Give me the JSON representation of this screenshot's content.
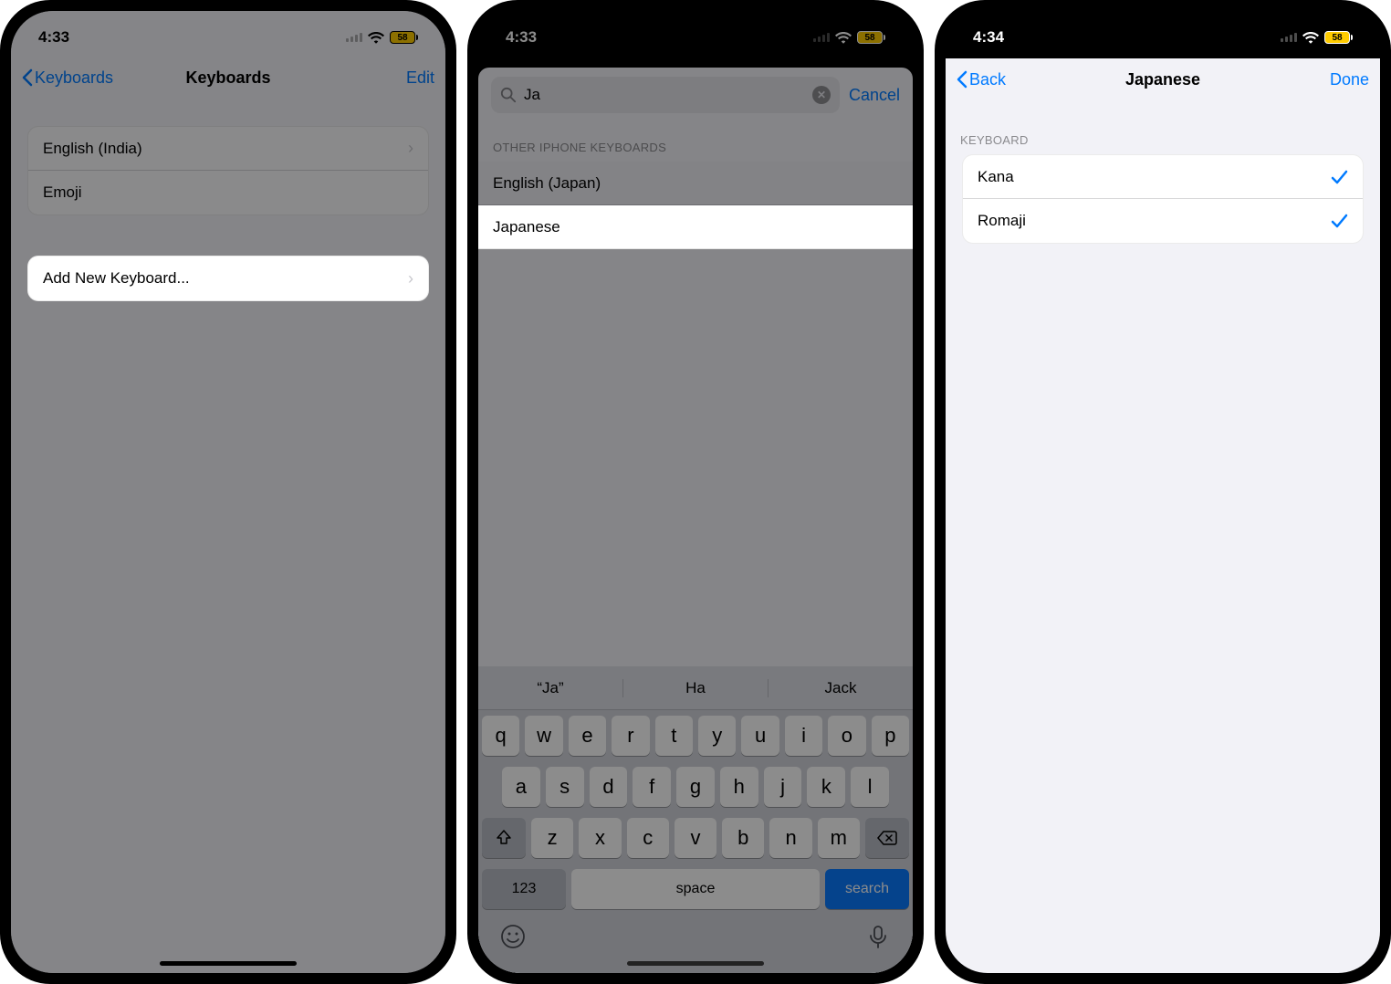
{
  "screen1": {
    "status": {
      "time": "4:33",
      "battery": "58"
    },
    "nav": {
      "back": "Keyboards",
      "title": "Keyboards",
      "edit": "Edit"
    },
    "keyboards": [
      {
        "label": "English (India)",
        "disclosure": true
      },
      {
        "label": "Emoji",
        "disclosure": false
      }
    ],
    "addNew": "Add New Keyboard..."
  },
  "screen2": {
    "status": {
      "time": "4:33",
      "battery": "58"
    },
    "search": {
      "query": "Ja",
      "cancel": "Cancel"
    },
    "sectionHeader": "OTHER IPHONE KEYBOARDS",
    "results": [
      {
        "label": "English (Japan)",
        "highlight": false
      },
      {
        "label": "Japanese",
        "highlight": true
      }
    ],
    "suggestions": [
      "“Ja”",
      "Ha",
      "Jack"
    ],
    "keyboard": {
      "row1": [
        "q",
        "w",
        "e",
        "r",
        "t",
        "y",
        "u",
        "i",
        "o",
        "p"
      ],
      "row2": [
        "a",
        "s",
        "d",
        "f",
        "g",
        "h",
        "j",
        "k",
        "l"
      ],
      "row3": [
        "z",
        "x",
        "c",
        "v",
        "b",
        "n",
        "m"
      ],
      "numKey": "123",
      "space": "space",
      "search": "search"
    }
  },
  "screen3": {
    "status": {
      "time": "4:34",
      "battery": "58"
    },
    "nav": {
      "back": "Back",
      "title": "Japanese",
      "done": "Done"
    },
    "sectionHeader": "KEYBOARD",
    "options": [
      {
        "label": "Kana",
        "checked": true
      },
      {
        "label": "Romaji",
        "checked": true
      }
    ]
  }
}
